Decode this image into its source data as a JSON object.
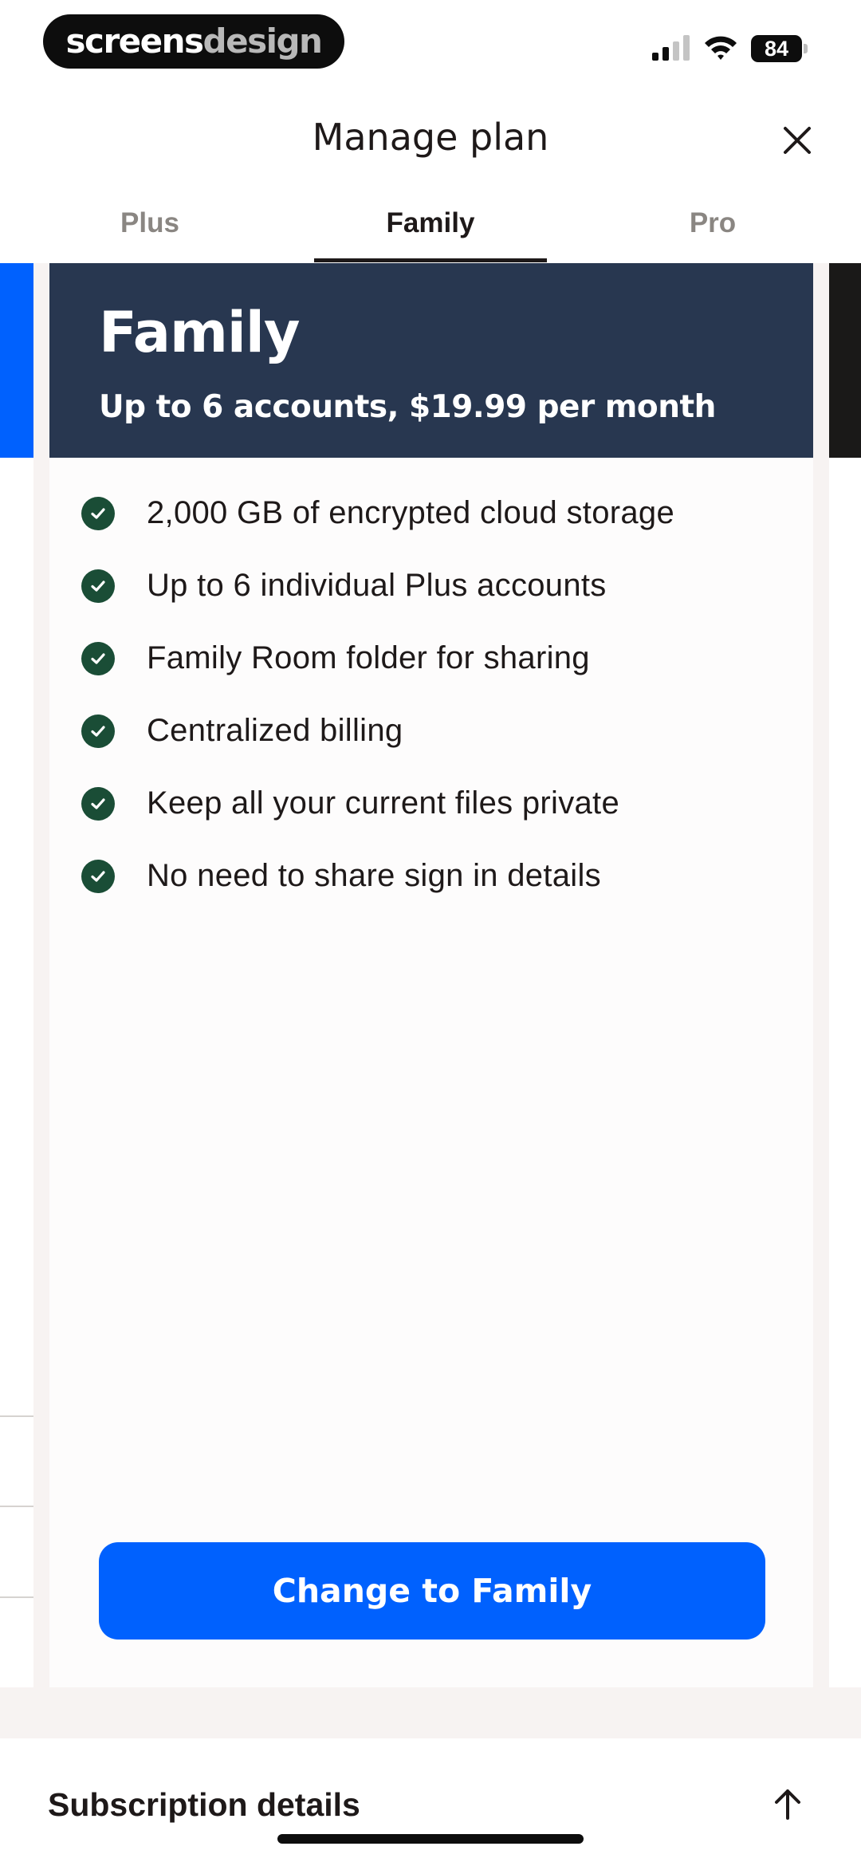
{
  "status_bar": {
    "brand_part1": "screens",
    "brand_part2": "design",
    "battery_level": "84",
    "icons": [
      "signal-icon",
      "wifi-icon",
      "battery-icon"
    ]
  },
  "header": {
    "title": "Manage plan",
    "close_icon": "close-icon"
  },
  "tabs": [
    {
      "label": "Plus",
      "selected": false
    },
    {
      "label": "Family",
      "selected": true
    },
    {
      "label": "Pro",
      "selected": false
    }
  ],
  "plan_card": {
    "name": "Family",
    "subtitle": "Up to 6 accounts, $19.99 per month",
    "header_color": "#283750",
    "features": [
      "2,000 GB of encrypted cloud storage",
      "Up to 6 individual Plus accounts",
      "Family Room folder for sharing",
      "Centralized billing",
      "Keep all your current files private",
      "No need to share sign in details"
    ],
    "check_color": "#1a4d36",
    "cta_label": "Change to Family",
    "cta_color": "#0061fe"
  },
  "subscription": {
    "title": "Subscription details",
    "toggle_icon": "arrow-up-icon"
  }
}
